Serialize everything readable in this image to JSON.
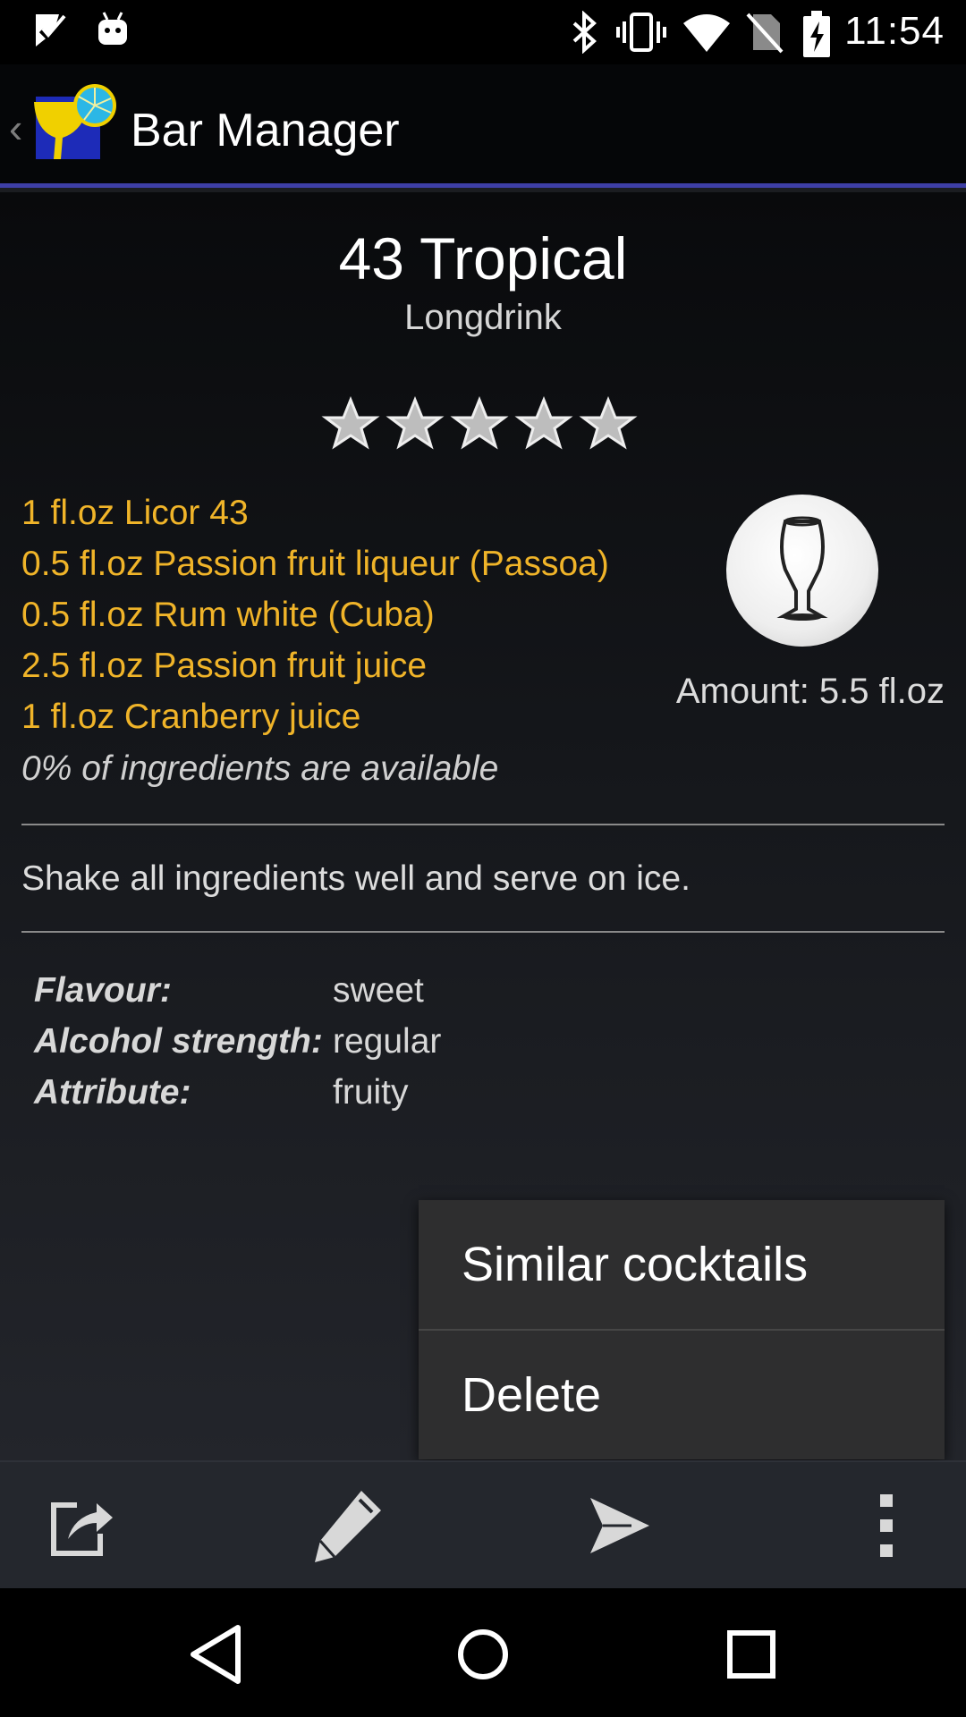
{
  "status_bar": {
    "time": "11:54",
    "icons": [
      "check-notification-icon",
      "android-notification-icon",
      "bluetooth-icon",
      "vibrate-icon",
      "wifi-icon",
      "no-sim-icon",
      "battery-charging-icon"
    ]
  },
  "action_bar": {
    "title": "Bar Manager",
    "icons": [
      "up-chevron-icon",
      "app-logo-icon"
    ],
    "accent_color": "#3e3fa6"
  },
  "cocktail": {
    "name": "43 Tropical",
    "type": "Longdrink",
    "rating_stars": 5,
    "ingredients": [
      "1 fl.oz Licor 43",
      "0.5 fl.oz Passion fruit liqueur (Passoa)",
      "0.5 fl.oz Rum white (Cuba)",
      "2.5 fl.oz Passion fruit juice",
      "1 fl.oz Cranberry juice"
    ],
    "ingredient_color": "#f0b429",
    "availability": "0% of ingredients are available",
    "glass_icon": "hurricane-glass-icon",
    "amount": "Amount: 5.5 fl.oz",
    "instructions": "Shake all ingredients well and serve on ice.",
    "properties": [
      {
        "label": "Flavour:",
        "value": "sweet"
      },
      {
        "label": "Alcohol strength:",
        "value": "regular"
      },
      {
        "label": "Attribute:",
        "value": "fruity"
      }
    ]
  },
  "popup_menu": {
    "items": [
      "Similar cocktails",
      "Delete"
    ]
  },
  "toolbar": {
    "icons": [
      "share-icon",
      "edit-pencil-icon",
      "send-icon",
      "overflow-menu-icon"
    ]
  },
  "nav_bar": {
    "icons": [
      "back-icon",
      "home-icon",
      "recents-icon"
    ]
  }
}
